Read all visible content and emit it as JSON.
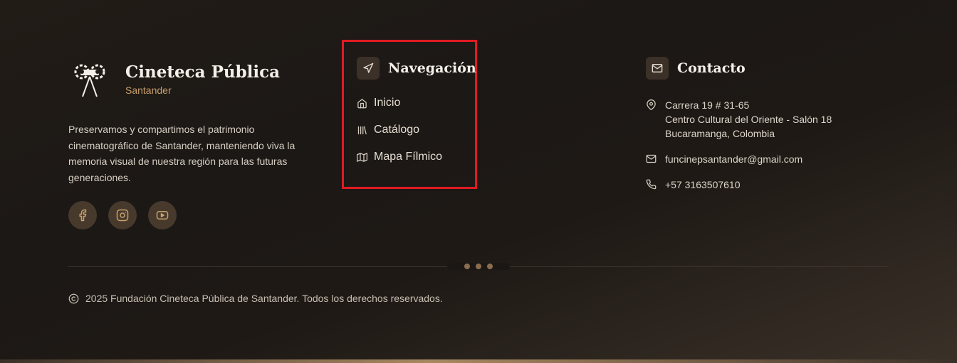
{
  "brand": {
    "title": "Cineteca Pública",
    "subtitle": "Santander",
    "description": "Preservamos y compartimos el patrimonio cinematográfico de Santander, manteniendo viva la memoria visual de nuestra región para las futuras generaciones.",
    "socials": [
      {
        "icon": "facebook-icon"
      },
      {
        "icon": "instagram-icon"
      },
      {
        "icon": "youtube-icon"
      }
    ]
  },
  "navigation": {
    "title": "Navegación",
    "icon": "navigation-arrow-icon",
    "items": [
      {
        "label": "Inicio",
        "icon": "home-icon"
      },
      {
        "label": "Catálogo",
        "icon": "library-icon"
      },
      {
        "label": "Mapa Fílmico",
        "icon": "map-icon"
      }
    ]
  },
  "contact": {
    "title": "Contacto",
    "icon": "mail-icon",
    "address_line1": "Carrera 19 # 31-65",
    "address_line2": "Centro Cultural del Oriente - Salón 18",
    "address_line3": "Bucaramanga, Colombia",
    "email": "funcinepsantander@gmail.com",
    "phone": "+57 3163507610"
  },
  "footer": {
    "copyright": "2025 Fundación Cineteca Pública de Santander. Todos los derechos reservados."
  },
  "colors": {
    "accent": "#c9a06c",
    "highlight_border": "#e11b22",
    "background": "#1c1815"
  }
}
